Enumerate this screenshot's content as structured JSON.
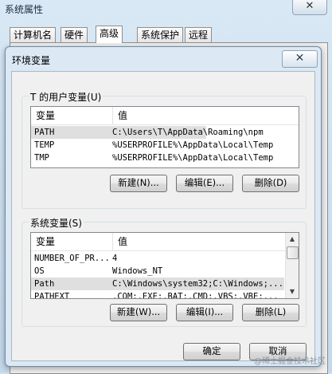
{
  "outer": {
    "title": "系统属性",
    "close_glyph": "✕",
    "tabs": [
      "计算机名",
      "硬件",
      "高级",
      "系统保护",
      "远程"
    ],
    "active_tab": "高级"
  },
  "dialog": {
    "title": "环境变量",
    "close_glyph": "✕",
    "user_group_label": "T 的用户变量(U)",
    "system_group_label": "系统变量(S)",
    "col_variable": "变量",
    "col_value": "值",
    "user_vars": [
      {
        "name": "PATH",
        "value": "C:\\Users\\T\\AppData\\Roaming\\npm"
      },
      {
        "name": "TEMP",
        "value": "%USERPROFILE%\\AppData\\Local\\Temp"
      },
      {
        "name": "TMP",
        "value": "%USERPROFILE%\\AppData\\Local\\Temp"
      }
    ],
    "system_vars": [
      {
        "name": "NUMBER_OF_PR...",
        "value": "4"
      },
      {
        "name": "OS",
        "value": "Windows_NT"
      },
      {
        "name": "Path",
        "value": "C:\\Windows\\system32;C:\\Windows;..."
      },
      {
        "name": "PATHEXT",
        "value": ".COM;.EXE;.BAT;.CMD;.VBS;.VBE;..."
      }
    ],
    "user_buttons": {
      "new": "新建(N)...",
      "edit": "编辑(E)...",
      "delete": "删除(D)"
    },
    "system_buttons": {
      "new": "新建(W)...",
      "edit": "编辑(I)...",
      "delete": "删除(L)"
    },
    "ok": "确定",
    "cancel": "取消"
  },
  "watermark": "@稀土掘金技术社区",
  "colors": {
    "window_frame": "#dce9f5",
    "panel": "#f0f0f0",
    "selection": "#dfdfdf"
  }
}
